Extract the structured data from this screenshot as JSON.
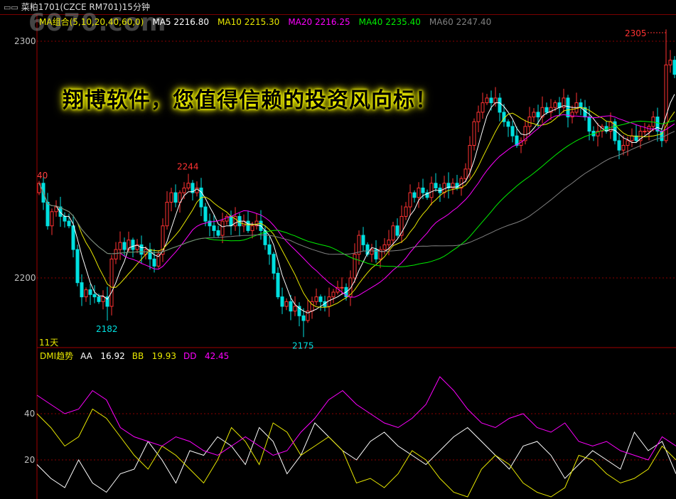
{
  "title": {
    "icon": "link-icon",
    "text": "菜粕1701(CZCE RM701)15分钟"
  },
  "watermark": "6070.com",
  "banner": "翔博软件，您值得信赖的投资风向标！",
  "ma_legend": {
    "group": {
      "text": "MA组合(5,10,20,40,60,0)",
      "color": "#e8e800"
    },
    "items": [
      {
        "name": "MA5",
        "value": "2216.80",
        "period": 5,
        "color": "#ffffff"
      },
      {
        "name": "MA10",
        "value": "2215.30",
        "period": 10,
        "color": "#e8e800"
      },
      {
        "name": "MA20",
        "value": "2216.25",
        "period": 20,
        "color": "#ff00ff"
      },
      {
        "name": "MA40",
        "value": "2235.40",
        "period": 40,
        "color": "#00ee00"
      },
      {
        "name": "MA60",
        "value": "2247.40",
        "period": 60,
        "color": "#808080"
      }
    ]
  },
  "dmi_legend": {
    "title": "DMI趋势",
    "items": [
      {
        "name": "AA",
        "value": "16.92",
        "color": "#ffffff"
      },
      {
        "name": "BB",
        "value": "19.93",
        "color": "#e8e800"
      },
      {
        "name": "DD",
        "value": "42.45",
        "color": "#ff00ff"
      }
    ]
  },
  "period_label": "11天",
  "colors": {
    "up": "#ff3232",
    "down": "#00e0e0",
    "grid": "#8b0000",
    "axis_text": "#c0c0c0"
  },
  "chart_data": [
    {
      "type": "candlestick",
      "title": "菜粕1701 15分钟",
      "y_ticks": [
        "2300",
        "2200"
      ],
      "ylim": [
        2170,
        2311
      ],
      "edge_label": "40",
      "annotations": [
        {
          "text": "2244",
          "index": 35,
          "value": 2244,
          "kind": "high"
        },
        {
          "text": "2182",
          "index": 16,
          "value": 2182,
          "kind": "low"
        },
        {
          "text": "2175",
          "index": 62,
          "value": 2175,
          "kind": "low"
        },
        {
          "text": "2305",
          "index": 147,
          "value": 2305,
          "kind": "high"
        }
      ],
      "open_start": 2236,
      "closes": [
        2240,
        2232,
        2222,
        2228,
        2230,
        2226,
        2224,
        2222,
        2212,
        2198,
        2192,
        2195,
        2193,
        2192,
        2190,
        2192,
        2188,
        2208,
        2212,
        2215,
        2212,
        2216,
        2212,
        2214,
        2210,
        2212,
        2208,
        2205,
        2210,
        2222,
        2232,
        2236,
        2232,
        2236,
        2238,
        2240,
        2236,
        2238,
        2230,
        2224,
        2222,
        2220,
        2218,
        2224,
        2226,
        2222,
        2226,
        2222,
        2224,
        2220,
        2222,
        2224,
        2220,
        2214,
        2210,
        2202,
        2192,
        2188,
        2190,
        2186,
        2188,
        2184,
        2182,
        2186,
        2190,
        2192,
        2190,
        2188,
        2192,
        2194,
        2196,
        2196,
        2192,
        2200,
        2210,
        2218,
        2214,
        2210,
        2212,
        2208,
        2212,
        2214,
        2216,
        2222,
        2218,
        2226,
        2230,
        2236,
        2234,
        2238,
        2236,
        2234,
        2240,
        2238,
        2236,
        2240,
        2238,
        2240,
        2238,
        2242,
        2246,
        2256,
        2266,
        2270,
        2274,
        2276,
        2274,
        2276,
        2270,
        2266,
        2264,
        2260,
        2256,
        2258,
        2264,
        2268,
        2270,
        2268,
        2272,
        2270,
        2272,
        2274,
        2272,
        2276,
        2268,
        2270,
        2274,
        2272,
        2268,
        2262,
        2260,
        2262,
        2264,
        2262,
        2266,
        2258,
        2254,
        2256,
        2258,
        2260,
        2258,
        2262,
        2262,
        2264,
        2268,
        2262,
        2258,
        2290,
        2292,
        2286
      ]
    },
    {
      "type": "line",
      "title": "DMI趋势",
      "y_ticks": [
        "40",
        "20"
      ],
      "ylim": [
        4,
        60
      ],
      "series": [
        {
          "name": "AA",
          "color": "#ffffff",
          "values": [
            18,
            12,
            8,
            20,
            10,
            6,
            14,
            16,
            28,
            20,
            10,
            24,
            22,
            30,
            26,
            18,
            34,
            28,
            14,
            22,
            36,
            30,
            24,
            20,
            28,
            32,
            26,
            22,
            18,
            24,
            30,
            34,
            28,
            22,
            16,
            26,
            28,
            22,
            12,
            18,
            24,
            20,
            16,
            32,
            24,
            28,
            14
          ]
        },
        {
          "name": "BB",
          "color": "#e8e800",
          "values": [
            40,
            34,
            26,
            30,
            42,
            38,
            30,
            22,
            16,
            26,
            22,
            16,
            10,
            20,
            34,
            28,
            18,
            36,
            32,
            22,
            26,
            30,
            24,
            10,
            12,
            8,
            14,
            24,
            20,
            12,
            6,
            4,
            16,
            22,
            18,
            10,
            6,
            4,
            8,
            22,
            20,
            14,
            10,
            12,
            16,
            26,
            20
          ]
        },
        {
          "name": "DD",
          "color": "#ff00ff",
          "values": [
            48,
            44,
            40,
            42,
            50,
            46,
            34,
            30,
            28,
            26,
            30,
            28,
            24,
            22,
            26,
            30,
            26,
            22,
            24,
            32,
            38,
            46,
            50,
            44,
            40,
            36,
            34,
            38,
            44,
            56,
            50,
            42,
            36,
            34,
            38,
            40,
            34,
            32,
            36,
            28,
            26,
            28,
            24,
            22,
            20,
            30,
            26
          ]
        }
      ]
    }
  ]
}
